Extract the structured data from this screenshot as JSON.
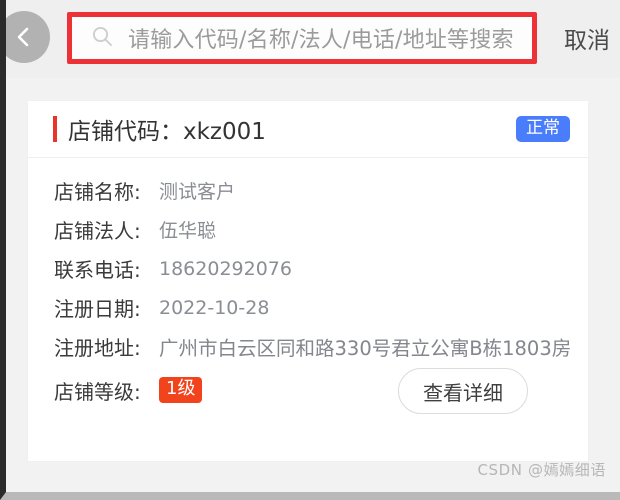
{
  "header": {
    "back_icon": "chevron-left-icon",
    "search": {
      "icon": "search-icon",
      "placeholder": "请输入代码/名称/法人/电话/地址等搜索",
      "value": ""
    },
    "cancel_label": "取消",
    "annotation_color": "#ec3237"
  },
  "card": {
    "title": "店铺代码：xkz001",
    "accent_color": "#e8342a",
    "status_badge": {
      "label": "正常",
      "bg_color": "#4a7dfc",
      "text_color": "#ffffff"
    },
    "rows": [
      {
        "label": "店铺名称:",
        "value": "测试客户"
      },
      {
        "label": "店铺法人:",
        "value": "伍华聪"
      },
      {
        "label": "联系电话:",
        "value": "18620292076"
      },
      {
        "label": "注册日期:",
        "value": "2022-10-28"
      },
      {
        "label": "注册地址:",
        "value": "广州市白云区同和路330号君立公寓B栋1803房"
      }
    ],
    "level_row": {
      "label": "店铺等级:",
      "badge": "1级",
      "badge_bg_color": "#f2441c",
      "badge_text_color": "#ffffff"
    },
    "detail_button_label": "查看详细"
  },
  "watermark": "CSDN @嫣嫣细语"
}
